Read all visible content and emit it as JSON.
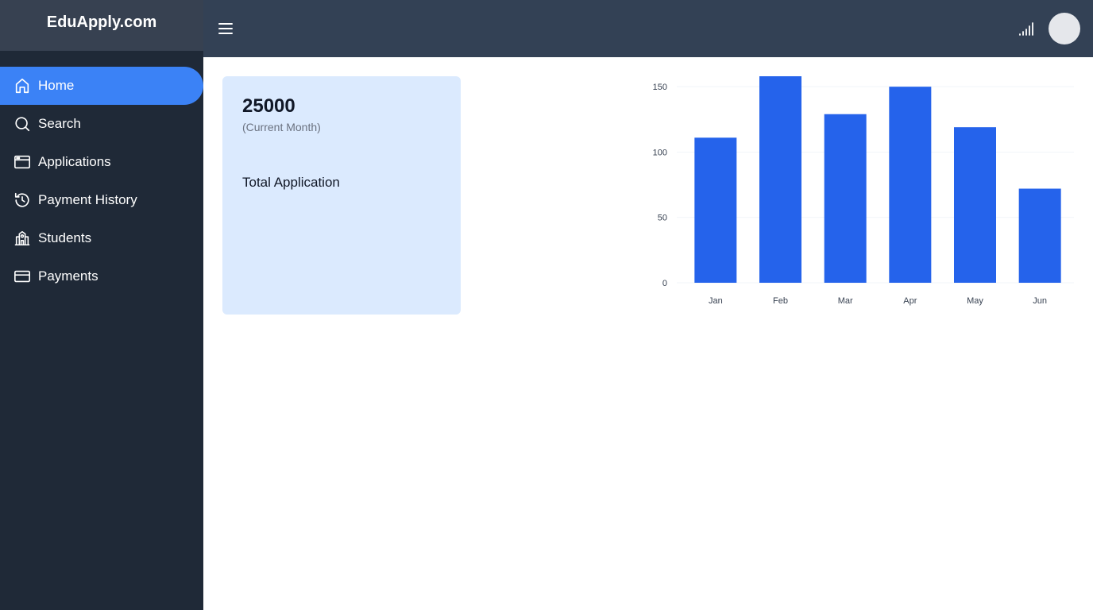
{
  "brand": {
    "title": "EduApply.com"
  },
  "sidebar": {
    "items": [
      {
        "label": "Home",
        "icon": "home-icon",
        "active": true
      },
      {
        "label": "Search",
        "icon": "search-icon",
        "active": false
      },
      {
        "label": "Applications",
        "icon": "browser-window-icon",
        "active": false
      },
      {
        "label": "Payment History",
        "icon": "history-icon",
        "active": false
      },
      {
        "label": "Students",
        "icon": "school-building-icon",
        "active": false
      },
      {
        "label": "Payments",
        "icon": "credit-card-icon",
        "active": false
      }
    ]
  },
  "topbar": {
    "menu_icon": "hamburger-menu-icon",
    "signal_icon": "signal-icon",
    "avatar": "avatar"
  },
  "stat_card": {
    "value": "25000",
    "period": "(Current Month)",
    "label": "Total Application"
  },
  "colors": {
    "sidebar_bg": "#1f2937",
    "topbar_bg": "#334155",
    "active_nav": "#3b82f6",
    "card_bg": "#dbeafe",
    "bar": "#2563eb"
  },
  "chart_data": {
    "type": "bar",
    "categories": [
      "Jan",
      "Feb",
      "Mar",
      "Apr",
      "May",
      "Jun"
    ],
    "values": [
      111,
      158,
      129,
      150,
      119,
      72
    ],
    "yticks": [
      0,
      50,
      100,
      150
    ],
    "ylim": [
      0,
      158
    ],
    "grid": true,
    "title": "",
    "xlabel": "",
    "ylabel": ""
  }
}
